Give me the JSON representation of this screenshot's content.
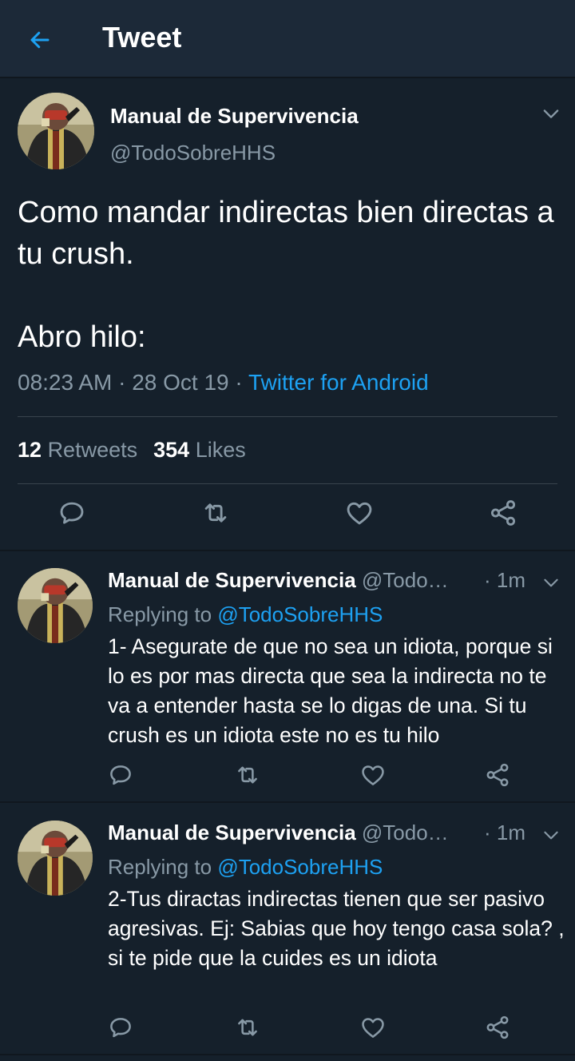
{
  "header": {
    "title": "Tweet"
  },
  "main_tweet": {
    "name": "Manual de Supervivencia",
    "handle": "@TodoSobreHHS",
    "text": "Como mandar indirectas bien directas a tu crush.\n\nAbro hilo:",
    "time": "08:23 AM",
    "date": "28 Oct 19",
    "source": "Twitter for Android",
    "retweet_count": "12",
    "retweet_label": "Retweets",
    "like_count": "354",
    "like_label": "Likes"
  },
  "replies": [
    {
      "name": "Manual de Supervivencia",
      "handle": "@Todo…",
      "time": "1m",
      "replying_label": "Replying to",
      "replying_to": "@TodoSobreHHS",
      "text": "1- Asegurate de que no sea un idiota, porque si lo es por mas directa que sea la indirecta no te va a entender hasta se lo digas de una. Si tu crush es un idiota este no es tu hilo"
    },
    {
      "name": "Manual de Supervivencia",
      "handle": "@Todo…",
      "time": "1m",
      "replying_label": "Replying to",
      "replying_to": "@TodoSobreHHS",
      "text": "2-Tus diractas indirectas tienen que ser pasivo agresivas. Ej: Sabias que hoy tengo casa sola? , si te pide que la cuides es un idiota"
    }
  ],
  "icons": {
    "back": "arrow-left-icon",
    "caret": "chevron-down-icon",
    "reply": "comment-icon",
    "retweet": "retweet-icon",
    "like": "heart-icon",
    "share": "share-icon"
  },
  "colors": {
    "background": "#15202b",
    "header": "#1c2938",
    "accent": "#1da1f2",
    "secondary_text": "#8899a6"
  }
}
